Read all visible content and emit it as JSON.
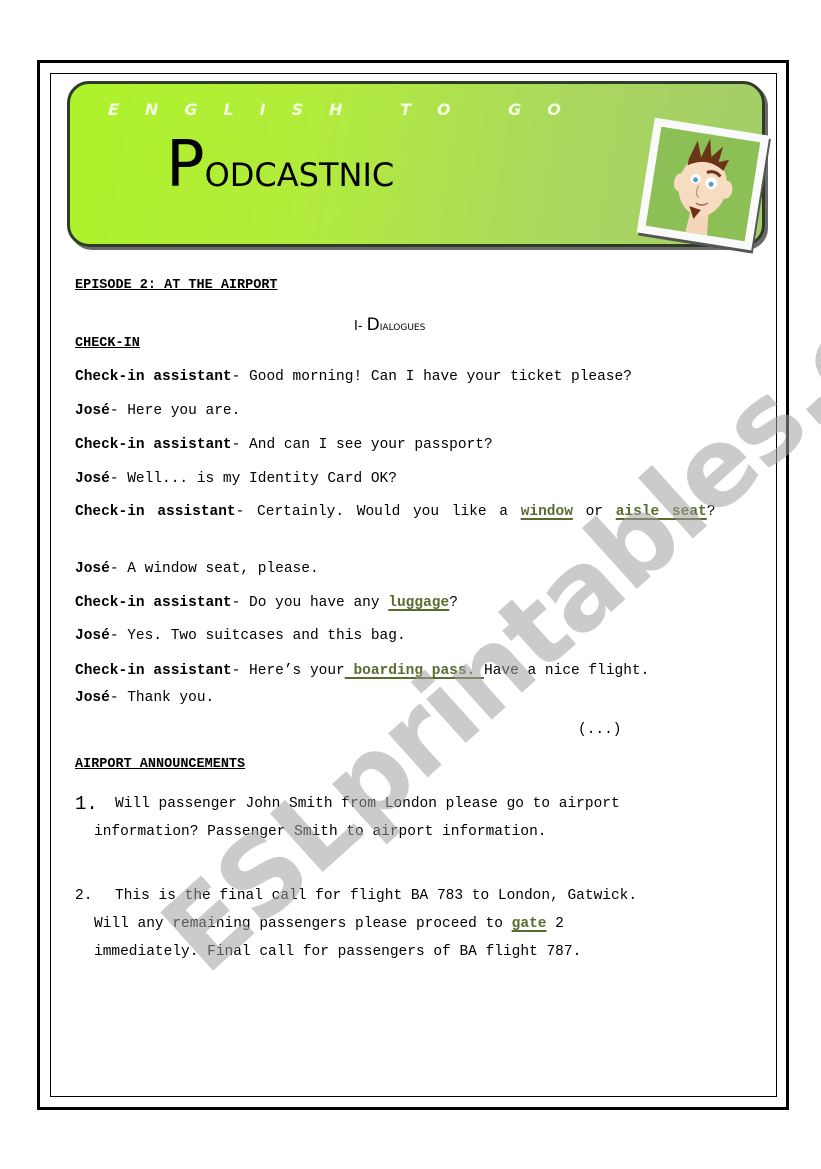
{
  "banner": {
    "tagline": "ENGLISH TO GO",
    "title_first": "P",
    "title_rest": "odcastnic",
    "accent": "#aef22a",
    "photo_icon": "cartoon-character-portrait"
  },
  "episode_heading": "EPISODE 2: AT THE AIRPORT",
  "section_heading": {
    "prefix": "I- ",
    "first": "D",
    "rest": "ialogues"
  },
  "checkin_heading": "CHECK-IN",
  "dialogue": [
    {
      "speaker": "Check-in assistant",
      "sep": "- ",
      "parts": [
        {
          "t": "Good morning! Can I have your ticket please?"
        }
      ]
    },
    {
      "speaker": "José",
      "sep": "- ",
      "parts": [
        {
          "t": "Here you are."
        }
      ]
    },
    {
      "speaker": "Check-in assistant",
      "sep": "- ",
      "parts": [
        {
          "t": "And can I see your passport?"
        }
      ]
    },
    {
      "speaker": "José",
      "sep": "- ",
      "parts": [
        {
          "t": "Well... is my Identity Card OK?"
        }
      ]
    },
    {
      "speaker": "Check-in assistant",
      "sep": "- ",
      "parts": [
        {
          "t": "Certainly. Would you like a "
        },
        {
          "v": "window"
        },
        {
          "t": " or "
        },
        {
          "v": "aisle seat"
        },
        {
          "t": "?"
        }
      ]
    },
    {
      "speaker": "José",
      "sep": "- ",
      "parts": [
        {
          "t": "A window seat, please."
        }
      ]
    },
    {
      "speaker": "Check-in assistant",
      "sep": "- ",
      "parts": [
        {
          "t": "Do you have any "
        },
        {
          "v": "luggage"
        },
        {
          "t": "?"
        }
      ]
    },
    {
      "speaker": "José",
      "sep": "- ",
      "parts": [
        {
          "t": "Yes. Two suitcases and this bag."
        }
      ]
    },
    {
      "speaker": "Check-in assistant",
      "sep": "- ",
      "parts": [
        {
          "t": "Here’s your"
        },
        {
          "v": " boarding pass. "
        },
        {
          "t": "Have a nice flight."
        }
      ]
    },
    {
      "speaker": "José",
      "sep": "- ",
      "parts": [
        {
          "t": "Thank you."
        }
      ]
    }
  ],
  "ellipsis": "(...)",
  "announcements_heading": "AIRPORT ANNOUNCEMENTS",
  "announcements": [
    {
      "num": "1.",
      "first": "Will passenger John Smith from London please go to airport",
      "rest": [
        {
          "t": "information? Passenger Smith to airport information."
        }
      ]
    },
    {
      "num": "2.",
      "first": "This is the final call for flight BA 783 to London, Gatwick.",
      "rest": [
        {
          "t": "Will any remaining passengers please proceed to "
        },
        {
          "v": "gate"
        },
        {
          "t": " 2 immediately. Final call for passengers of BA flight 787."
        }
      ]
    }
  ],
  "vocab_color": "#5a6b2e",
  "watermark": "ESLprintables.com"
}
